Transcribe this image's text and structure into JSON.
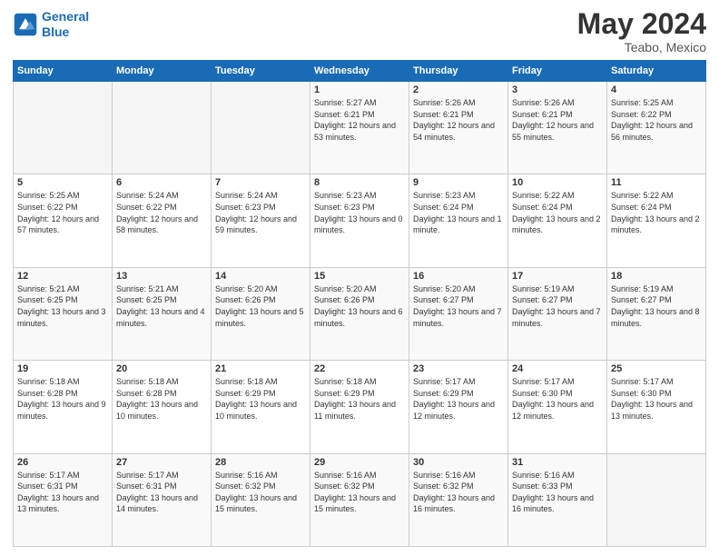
{
  "header": {
    "logo_line1": "General",
    "logo_line2": "Blue",
    "month": "May 2024",
    "location": "Teabo, Mexico"
  },
  "weekdays": [
    "Sunday",
    "Monday",
    "Tuesday",
    "Wednesday",
    "Thursday",
    "Friday",
    "Saturday"
  ],
  "weeks": [
    [
      {
        "day": "",
        "sunrise": "",
        "sunset": "",
        "daylight": ""
      },
      {
        "day": "",
        "sunrise": "",
        "sunset": "",
        "daylight": ""
      },
      {
        "day": "",
        "sunrise": "",
        "sunset": "",
        "daylight": ""
      },
      {
        "day": "1",
        "sunrise": "Sunrise: 5:27 AM",
        "sunset": "Sunset: 6:21 PM",
        "daylight": "Daylight: 12 hours and 53 minutes."
      },
      {
        "day": "2",
        "sunrise": "Sunrise: 5:26 AM",
        "sunset": "Sunset: 6:21 PM",
        "daylight": "Daylight: 12 hours and 54 minutes."
      },
      {
        "day": "3",
        "sunrise": "Sunrise: 5:26 AM",
        "sunset": "Sunset: 6:21 PM",
        "daylight": "Daylight: 12 hours and 55 minutes."
      },
      {
        "day": "4",
        "sunrise": "Sunrise: 5:25 AM",
        "sunset": "Sunset: 6:22 PM",
        "daylight": "Daylight: 12 hours and 56 minutes."
      }
    ],
    [
      {
        "day": "5",
        "sunrise": "Sunrise: 5:25 AM",
        "sunset": "Sunset: 6:22 PM",
        "daylight": "Daylight: 12 hours and 57 minutes."
      },
      {
        "day": "6",
        "sunrise": "Sunrise: 5:24 AM",
        "sunset": "Sunset: 6:22 PM",
        "daylight": "Daylight: 12 hours and 58 minutes."
      },
      {
        "day": "7",
        "sunrise": "Sunrise: 5:24 AM",
        "sunset": "Sunset: 6:23 PM",
        "daylight": "Daylight: 12 hours and 59 minutes."
      },
      {
        "day": "8",
        "sunrise": "Sunrise: 5:23 AM",
        "sunset": "Sunset: 6:23 PM",
        "daylight": "Daylight: 13 hours and 0 minutes."
      },
      {
        "day": "9",
        "sunrise": "Sunrise: 5:23 AM",
        "sunset": "Sunset: 6:24 PM",
        "daylight": "Daylight: 13 hours and 1 minute."
      },
      {
        "day": "10",
        "sunrise": "Sunrise: 5:22 AM",
        "sunset": "Sunset: 6:24 PM",
        "daylight": "Daylight: 13 hours and 2 minutes."
      },
      {
        "day": "11",
        "sunrise": "Sunrise: 5:22 AM",
        "sunset": "Sunset: 6:24 PM",
        "daylight": "Daylight: 13 hours and 2 minutes."
      }
    ],
    [
      {
        "day": "12",
        "sunrise": "Sunrise: 5:21 AM",
        "sunset": "Sunset: 6:25 PM",
        "daylight": "Daylight: 13 hours and 3 minutes."
      },
      {
        "day": "13",
        "sunrise": "Sunrise: 5:21 AM",
        "sunset": "Sunset: 6:25 PM",
        "daylight": "Daylight: 13 hours and 4 minutes."
      },
      {
        "day": "14",
        "sunrise": "Sunrise: 5:20 AM",
        "sunset": "Sunset: 6:26 PM",
        "daylight": "Daylight: 13 hours and 5 minutes."
      },
      {
        "day": "15",
        "sunrise": "Sunrise: 5:20 AM",
        "sunset": "Sunset: 6:26 PM",
        "daylight": "Daylight: 13 hours and 6 minutes."
      },
      {
        "day": "16",
        "sunrise": "Sunrise: 5:20 AM",
        "sunset": "Sunset: 6:27 PM",
        "daylight": "Daylight: 13 hours and 7 minutes."
      },
      {
        "day": "17",
        "sunrise": "Sunrise: 5:19 AM",
        "sunset": "Sunset: 6:27 PM",
        "daylight": "Daylight: 13 hours and 7 minutes."
      },
      {
        "day": "18",
        "sunrise": "Sunrise: 5:19 AM",
        "sunset": "Sunset: 6:27 PM",
        "daylight": "Daylight: 13 hours and 8 minutes."
      }
    ],
    [
      {
        "day": "19",
        "sunrise": "Sunrise: 5:18 AM",
        "sunset": "Sunset: 6:28 PM",
        "daylight": "Daylight: 13 hours and 9 minutes."
      },
      {
        "day": "20",
        "sunrise": "Sunrise: 5:18 AM",
        "sunset": "Sunset: 6:28 PM",
        "daylight": "Daylight: 13 hours and 10 minutes."
      },
      {
        "day": "21",
        "sunrise": "Sunrise: 5:18 AM",
        "sunset": "Sunset: 6:29 PM",
        "daylight": "Daylight: 13 hours and 10 minutes."
      },
      {
        "day": "22",
        "sunrise": "Sunrise: 5:18 AM",
        "sunset": "Sunset: 6:29 PM",
        "daylight": "Daylight: 13 hours and 11 minutes."
      },
      {
        "day": "23",
        "sunrise": "Sunrise: 5:17 AM",
        "sunset": "Sunset: 6:29 PM",
        "daylight": "Daylight: 13 hours and 12 minutes."
      },
      {
        "day": "24",
        "sunrise": "Sunrise: 5:17 AM",
        "sunset": "Sunset: 6:30 PM",
        "daylight": "Daylight: 13 hours and 12 minutes."
      },
      {
        "day": "25",
        "sunrise": "Sunrise: 5:17 AM",
        "sunset": "Sunset: 6:30 PM",
        "daylight": "Daylight: 13 hours and 13 minutes."
      }
    ],
    [
      {
        "day": "26",
        "sunrise": "Sunrise: 5:17 AM",
        "sunset": "Sunset: 6:31 PM",
        "daylight": "Daylight: 13 hours and 13 minutes."
      },
      {
        "day": "27",
        "sunrise": "Sunrise: 5:17 AM",
        "sunset": "Sunset: 6:31 PM",
        "daylight": "Daylight: 13 hours and 14 minutes."
      },
      {
        "day": "28",
        "sunrise": "Sunrise: 5:16 AM",
        "sunset": "Sunset: 6:32 PM",
        "daylight": "Daylight: 13 hours and 15 minutes."
      },
      {
        "day": "29",
        "sunrise": "Sunrise: 5:16 AM",
        "sunset": "Sunset: 6:32 PM",
        "daylight": "Daylight: 13 hours and 15 minutes."
      },
      {
        "day": "30",
        "sunrise": "Sunrise: 5:16 AM",
        "sunset": "Sunset: 6:32 PM",
        "daylight": "Daylight: 13 hours and 16 minutes."
      },
      {
        "day": "31",
        "sunrise": "Sunrise: 5:16 AM",
        "sunset": "Sunset: 6:33 PM",
        "daylight": "Daylight: 13 hours and 16 minutes."
      },
      {
        "day": "",
        "sunrise": "",
        "sunset": "",
        "daylight": ""
      }
    ]
  ]
}
